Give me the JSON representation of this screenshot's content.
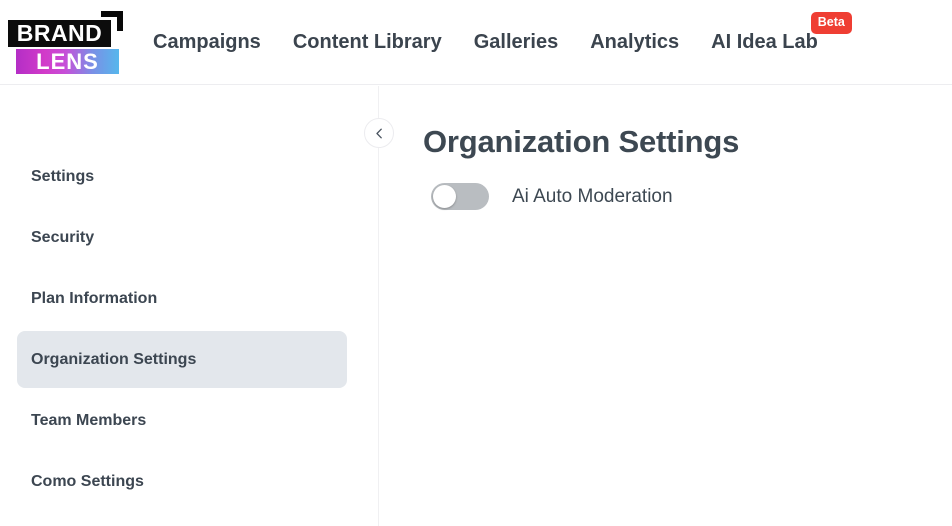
{
  "header": {
    "logo": {
      "top_word": "BRAND",
      "bottom_word": "LENS",
      "bracket_color": "#0c0c0c",
      "gradient_from": "#b42ec6",
      "gradient_to": "#56b7ec"
    },
    "nav": [
      {
        "label": "Campaigns",
        "badge": null
      },
      {
        "label": "Content Library",
        "badge": null
      },
      {
        "label": "Galleries",
        "badge": null
      },
      {
        "label": "Analytics",
        "badge": null
      },
      {
        "label": "AI Idea Lab",
        "badge": "Beta"
      }
    ],
    "badge_color": "#ef3e33",
    "text_color": "#3b444e"
  },
  "sidebar": {
    "collapse_icon": "chevron-left-icon",
    "active_index": 3,
    "active_bg": "#e3e7ec",
    "items": [
      {
        "label": "Settings"
      },
      {
        "label": "Security"
      },
      {
        "label": "Plan Information"
      },
      {
        "label": "Organization Settings"
      },
      {
        "label": "Team Members"
      },
      {
        "label": "Como Settings"
      }
    ]
  },
  "main": {
    "title": "Organization Settings",
    "settings": [
      {
        "label": "Ai Auto Moderation",
        "state": "off",
        "track_color": "#b9bdc1"
      }
    ]
  }
}
